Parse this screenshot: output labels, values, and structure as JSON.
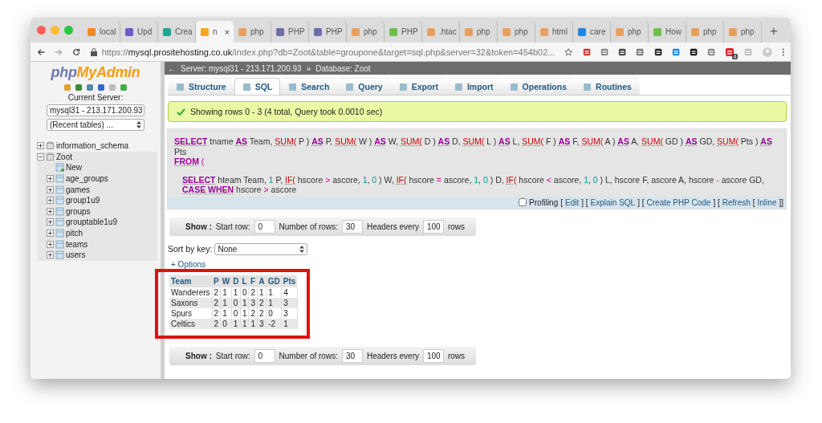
{
  "browser": {
    "tabs": [
      {
        "label": "local",
        "selected": false
      },
      {
        "label": "Upd",
        "selected": false
      },
      {
        "label": "Crea",
        "selected": false
      },
      {
        "label": "n",
        "selected": true,
        "close": "×"
      },
      {
        "label": "php",
        "selected": false
      },
      {
        "label": "PHP",
        "selected": false
      },
      {
        "label": "PHP",
        "selected": false
      },
      {
        "label": "php",
        "selected": false
      },
      {
        "label": "PHP",
        "selected": false
      },
      {
        "label": ".htac",
        "selected": false
      },
      {
        "label": "php",
        "selected": false
      },
      {
        "label": "php",
        "selected": false
      },
      {
        "label": "html",
        "selected": false
      },
      {
        "label": "care",
        "selected": false
      },
      {
        "label": "php",
        "selected": false
      },
      {
        "label": "How",
        "selected": false
      },
      {
        "label": "php",
        "selected": false
      },
      {
        "label": "php",
        "selected": false
      }
    ],
    "new_tab": "+",
    "url": {
      "scheme": "https://",
      "host": "mysql.prositehosting.co.uk",
      "path": "/index.php?db=Zoot&table=groupone&target=sql.php&server=32&token=454b02..."
    },
    "extension_badge": "4"
  },
  "sidebar": {
    "logo_php": "php",
    "logo_rest": "MyAdmin",
    "current_server_label": "Current Server:",
    "server_select": "mysql31 - 213.171.200.93",
    "recent_select": "(Recent tables) ...",
    "tree": [
      {
        "label": "information_schema",
        "expanded": false
      },
      {
        "label": "Zoot",
        "expanded": true,
        "children": [
          {
            "label": "New",
            "kind": "new"
          },
          {
            "label": "age_groups",
            "kind": "table",
            "expanded": false
          },
          {
            "label": "games",
            "kind": "table",
            "expanded": false
          },
          {
            "label": "group1u9",
            "kind": "table",
            "expanded": false
          },
          {
            "label": "groups",
            "kind": "table",
            "expanded": false
          },
          {
            "label": "grouptable1u9",
            "kind": "table",
            "expanded": false
          },
          {
            "label": "pitch",
            "kind": "table",
            "expanded": false
          },
          {
            "label": "teams",
            "kind": "table",
            "expanded": false
          },
          {
            "label": "users",
            "kind": "table",
            "expanded": false
          }
        ]
      }
    ]
  },
  "breadcrumb": {
    "back": "←",
    "server": "Server: mysql31 - 213.171.200.93",
    "separator": "»",
    "database": "Database: Zoot"
  },
  "tabs": [
    {
      "label": "Structure",
      "selected": false
    },
    {
      "label": "SQL",
      "selected": true
    },
    {
      "label": "Search",
      "selected": false
    },
    {
      "label": "Query",
      "selected": false
    },
    {
      "label": "Export",
      "selected": false
    },
    {
      "label": "Import",
      "selected": false
    },
    {
      "label": "Operations",
      "selected": false
    },
    {
      "label": "Routines",
      "selected": false
    }
  ],
  "message": "Showing rows 0 - 3 (4 total, Query took 0.0010 sec)",
  "sql": [
    {
      "indent": false,
      "tokens": [
        {
          "kind": "kw",
          "text": "SELECT"
        },
        {
          "kind": "txt",
          "text": " tname "
        },
        {
          "kind": "kw",
          "text": "AS"
        },
        {
          "kind": "txt",
          "text": " Team, "
        },
        {
          "kind": "fn",
          "text": "SUM("
        },
        {
          "kind": "txt",
          "text": " P ) "
        },
        {
          "kind": "kw",
          "text": "AS"
        },
        {
          "kind": "txt",
          "text": " P, "
        },
        {
          "kind": "fn",
          "text": "SUM("
        },
        {
          "kind": "txt",
          "text": " W ) "
        },
        {
          "kind": "kw",
          "text": "AS"
        },
        {
          "kind": "txt",
          "text": " W, "
        },
        {
          "kind": "fn",
          "text": "SUM("
        },
        {
          "kind": "txt",
          "text": " D ) "
        },
        {
          "kind": "kw",
          "text": "AS"
        },
        {
          "kind": "txt",
          "text": " D, "
        },
        {
          "kind": "fn",
          "text": "SUM("
        },
        {
          "kind": "txt",
          "text": " L ) "
        },
        {
          "kind": "kw",
          "text": "AS"
        },
        {
          "kind": "txt",
          "text": " L, "
        },
        {
          "kind": "fn",
          "text": "SUM("
        },
        {
          "kind": "txt",
          "text": " F ) "
        },
        {
          "kind": "kw",
          "text": "AS"
        },
        {
          "kind": "txt",
          "text": " F, "
        },
        {
          "kind": "fn",
          "text": "SUM("
        },
        {
          "kind": "txt",
          "text": " A ) "
        },
        {
          "kind": "kw",
          "text": "AS"
        },
        {
          "kind": "txt",
          "text": " A, "
        },
        {
          "kind": "fn",
          "text": "SUM("
        },
        {
          "kind": "txt",
          "text": " GD ) "
        },
        {
          "kind": "kw",
          "text": "AS"
        },
        {
          "kind": "txt",
          "text": " GD, "
        },
        {
          "kind": "fn",
          "text": "SUM("
        },
        {
          "kind": "txt",
          "text": " Pts ) "
        },
        {
          "kind": "kw",
          "text": "AS"
        },
        {
          "kind": "txt",
          "text": " Pts"
        }
      ]
    },
    {
      "indent": false,
      "tokens": [
        {
          "kind": "kw",
          "text": "FROM"
        },
        {
          "kind": "op",
          "text": " ("
        }
      ]
    },
    {
      "indent": true,
      "tokens": [
        {
          "kind": "kw",
          "text": "SELECT"
        },
        {
          "kind": "txt",
          "text": " hteam Team, "
        },
        {
          "kind": "num",
          "text": "1"
        },
        {
          "kind": "txt",
          "text": " P, "
        },
        {
          "kind": "fn",
          "text": "IF("
        },
        {
          "kind": "txt",
          "text": " hscore "
        },
        {
          "kind": "op",
          "text": ">"
        },
        {
          "kind": "txt",
          "text": " ascore, "
        },
        {
          "kind": "num",
          "text": "1"
        },
        {
          "kind": "txt",
          "text": ", "
        },
        {
          "kind": "num",
          "text": "0"
        },
        {
          "kind": "txt",
          "text": " ) W, "
        },
        {
          "kind": "fn",
          "text": "IF("
        },
        {
          "kind": "txt",
          "text": " hscore "
        },
        {
          "kind": "op",
          "text": "="
        },
        {
          "kind": "txt",
          "text": " ascore, "
        },
        {
          "kind": "num",
          "text": "1"
        },
        {
          "kind": "txt",
          "text": ", "
        },
        {
          "kind": "num",
          "text": "0"
        },
        {
          "kind": "txt",
          "text": " ) D, "
        },
        {
          "kind": "fn",
          "text": "IF("
        },
        {
          "kind": "txt",
          "text": " hscore "
        },
        {
          "kind": "op",
          "text": "<"
        },
        {
          "kind": "txt",
          "text": " ascore, "
        },
        {
          "kind": "num",
          "text": "1"
        },
        {
          "kind": "txt",
          "text": ", "
        },
        {
          "kind": "num",
          "text": "0"
        },
        {
          "kind": "txt",
          "text": " ) L, hscore F, ascore A, hscore "
        },
        {
          "kind": "op",
          "text": "-"
        },
        {
          "kind": "txt",
          "text": " ascore GD,"
        }
      ]
    },
    {
      "indent": true,
      "tokens": [
        {
          "kind": "kw",
          "text": "CASE WHEN"
        },
        {
          "kind": "txt",
          "text": " hscore "
        },
        {
          "kind": "op",
          "text": ">"
        },
        {
          "kind": "txt",
          "text": " ascore"
        }
      ]
    }
  ],
  "profiling": {
    "label": "Profiling",
    "checked": false,
    "parts": [
      {
        "kind": "text",
        "text": "["
      },
      {
        "kind": "link",
        "text": "Edit"
      },
      {
        "kind": "text",
        "text": "] ["
      },
      {
        "kind": "link",
        "text": "Explain SQL"
      },
      {
        "kind": "text",
        "text": "] ["
      },
      {
        "kind": "link",
        "text": "Create PHP Code"
      },
      {
        "kind": "text",
        "text": "] ["
      },
      {
        "kind": "link",
        "text": "Refresh"
      },
      {
        "kind": "text",
        "text": "["
      },
      {
        "kind": "link",
        "text": "Inline"
      },
      {
        "kind": "text",
        "text": "]]"
      }
    ]
  },
  "nav_top": {
    "show": "Show :",
    "start_label": "Start row:",
    "start": "0",
    "rows_label": "Number of rows:",
    "rows": "30",
    "headers_label": "Headers every",
    "headers": "100",
    "suffix": "rows"
  },
  "sort": {
    "label": "Sort by key:",
    "value": "None"
  },
  "options": "+ Options",
  "results": {
    "columns": [
      "Team",
      "P",
      "W",
      "D",
      "L",
      "F",
      "A",
      "GD",
      "Pts"
    ],
    "rows": [
      [
        "Wanderers",
        "2",
        "1",
        "1",
        "0",
        "2",
        "1",
        "1",
        "4"
      ],
      [
        "Saxons",
        "2",
        "1",
        "0",
        "1",
        "3",
        "2",
        "1",
        "3"
      ],
      [
        "Spurs",
        "2",
        "1",
        "0",
        "1",
        "2",
        "2",
        "0",
        "3"
      ],
      [
        "Celtics",
        "2",
        "0",
        "1",
        "1",
        "1",
        "3",
        "-2",
        "1"
      ]
    ]
  },
  "nav_bottom": {
    "show": "Show :",
    "start_label": "Start row:",
    "start": "0",
    "rows_label": "Number of rows:",
    "rows": "30",
    "headers_label": "Headers every",
    "headers": "100",
    "suffix": "rows"
  }
}
